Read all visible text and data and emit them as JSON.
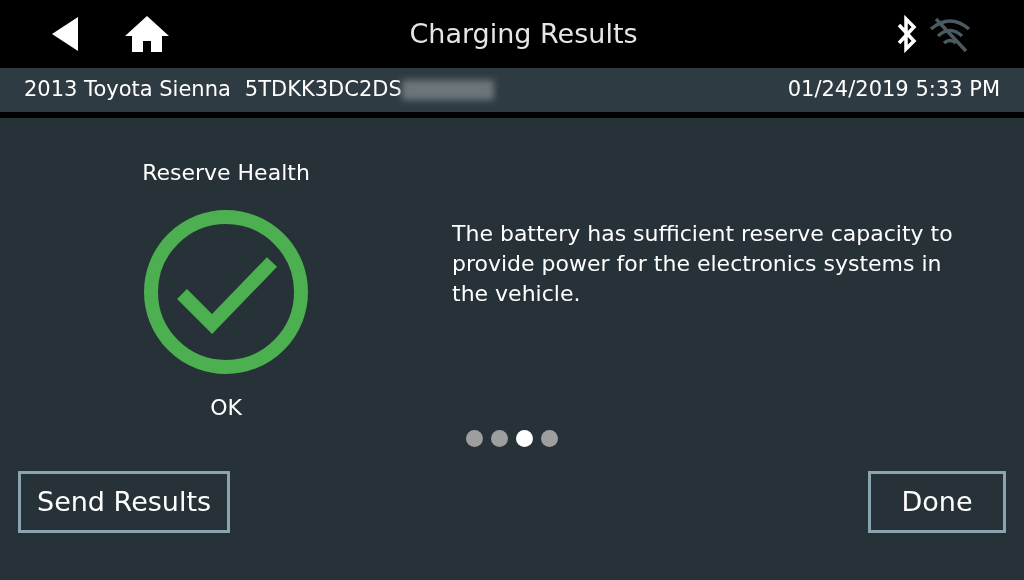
{
  "header": {
    "title": "Charging Results"
  },
  "vehicle_bar": {
    "vehicle": "2013 Toyota Sienna",
    "vin": "5TDKK3DC2DS",
    "datetime": "01/24/2019 5:33 PM"
  },
  "result": {
    "heading": "Reserve Health",
    "kind": "ok",
    "status": "OK",
    "message": "The battery has sufficient reserve capacity to provide power for the electronics systems in the vehicle."
  },
  "pages": [
    {
      "selected": false
    },
    {
      "selected": false
    },
    {
      "selected": true
    },
    {
      "selected": false
    }
  ],
  "buttons": [
    {
      "label": "Send Results"
    },
    {
      "label": "Done"
    }
  ]
}
